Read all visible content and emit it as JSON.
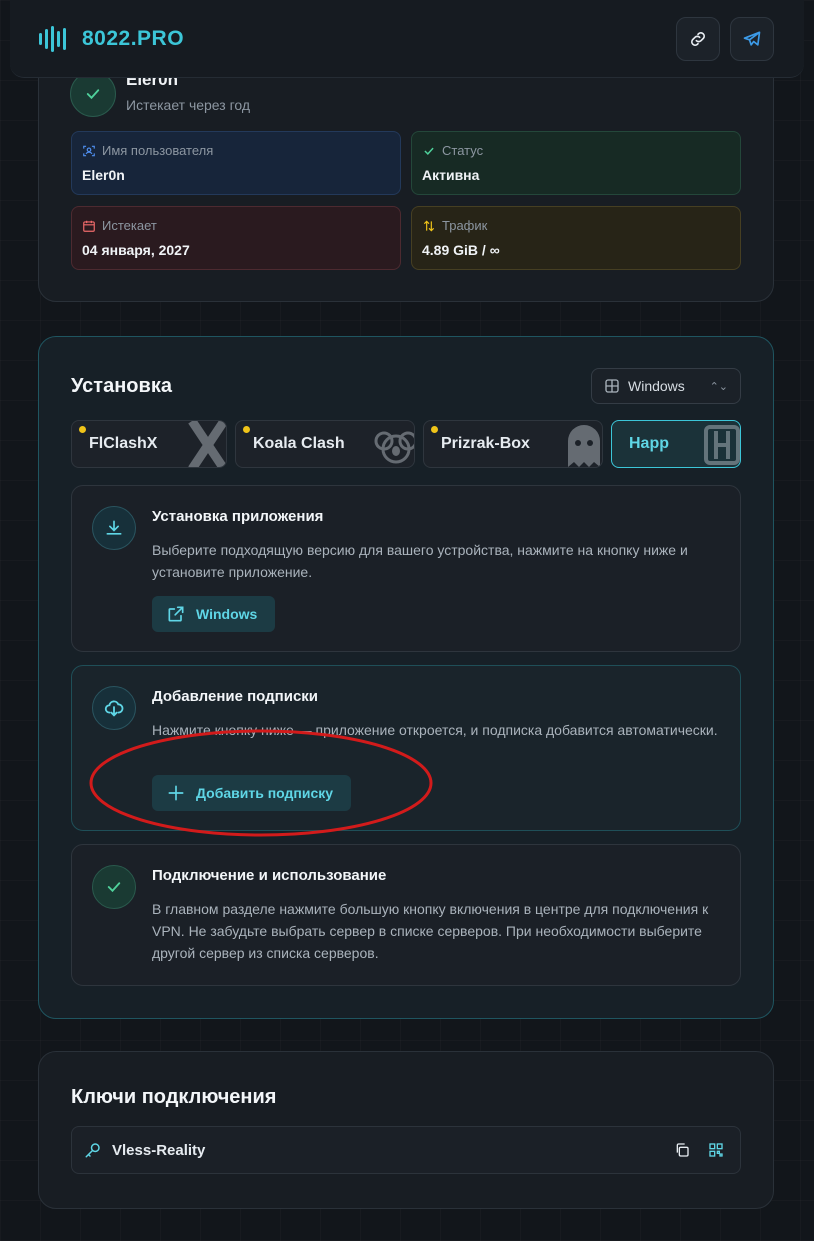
{
  "header": {
    "brand": "8022.PRO",
    "brand_color": "#3cc6d8",
    "link_icon": "link-icon",
    "telegram_icon": "telegram-icon"
  },
  "profile": {
    "username": "Eler0n",
    "expires_note": "Истекает через год",
    "fields": {
      "username_label": "Имя пользователя",
      "username_value": "Eler0n",
      "status_label": "Статус",
      "status_value": "Активна",
      "expires_label": "Истекает",
      "expires_value": "04 января, 2027",
      "traffic_label": "Трафик",
      "traffic_value": "4.89 GiB / ∞"
    }
  },
  "install": {
    "title": "Установка",
    "platform_select": "Windows",
    "apps": [
      {
        "label": "FlClashX",
        "has_dot": true
      },
      {
        "label": "Koala Clash",
        "has_dot": true
      },
      {
        "label": "Prizrak-Box",
        "has_dot": true
      },
      {
        "label": "Happ",
        "active": true
      }
    ],
    "steps": {
      "install_app": {
        "title": "Установка приложения",
        "text": "Выберите подходящую версию для вашего устройства, нажмите на кнопку ниже и установите приложение.",
        "button": "Windows"
      },
      "add_sub": {
        "title": "Добавление подписки",
        "text": "Нажмите кнопку ниже — приложение откроется, и подписка добавится автоматически.",
        "button": "Добавить подписку"
      },
      "connect": {
        "title": "Подключение и использование",
        "text": "В главном разделе нажмите большую кнопку включения в центре для подключения к VPN. Не забудьте выбрать сервер в списке серверов. При необходимости выберите другой сервер из списка серверов."
      }
    }
  },
  "keys": {
    "title": "Ключи подключения",
    "items": [
      {
        "label": "Vless-Reality"
      }
    ]
  }
}
